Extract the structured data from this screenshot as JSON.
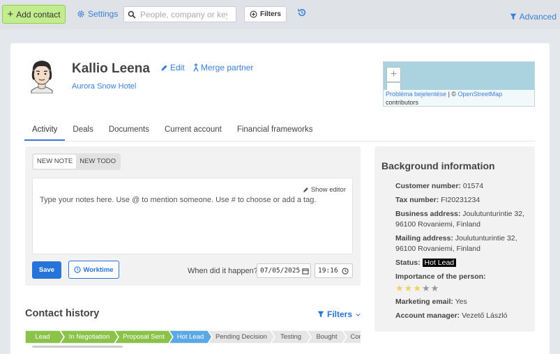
{
  "toolbar": {
    "add_contact": "Add contact",
    "settings": "Settings",
    "search_placeholder": "People, company or keyw",
    "filters": "Filters",
    "advanced": "Advanced"
  },
  "contact": {
    "name": "Kallio Leena",
    "edit": "Edit",
    "merge": "Merge partner",
    "company": "Aurora Snow Hotel"
  },
  "map": {
    "zoom_in": "+",
    "report_problem": "Probléma bejelentése",
    "separator": " | © ",
    "osm": "OpenStreetMap",
    "contributors": "contributors"
  },
  "tabs": [
    {
      "label": "Activity",
      "active": true
    },
    {
      "label": "Deals"
    },
    {
      "label": "Documents"
    },
    {
      "label": "Current account"
    },
    {
      "label": "Financial frameworks"
    }
  ],
  "note": {
    "tab_new_note": "NEW NOTE",
    "tab_new_todo": "NEW TODO",
    "show_editor": "Show editor",
    "placeholder": "Type your notes here. Use @ to mention someone. Use # to choose or add a tag.",
    "save": "Save",
    "worktime": "Worktime",
    "when_label": "When did it happen?",
    "date": "07/05/2025",
    "time": "19:16"
  },
  "history": {
    "title": "Contact history",
    "filters": "Filters",
    "stages": [
      {
        "label": "Lead",
        "color": "#8bc34a"
      },
      {
        "label": "In Negotiation",
        "color": "#8bc34a"
      },
      {
        "label": "Proposal Sent",
        "color": "#8bc34a"
      },
      {
        "label": "Hot Lead",
        "color": "#5aa9e6"
      },
      {
        "label": "Pending Decision",
        "color": "#e6e6e6"
      },
      {
        "label": "Testing",
        "color": "#e6e6e6"
      },
      {
        "label": "Bought",
        "color": "#e6e6e6"
      },
      {
        "label": "Contr",
        "color": "#e6e6e6"
      }
    ]
  },
  "background": {
    "title": "Background information",
    "customer_number_label": "Customer number:",
    "customer_number": "01574",
    "tax_number_label": "Tax number:",
    "tax_number": "FI20231234",
    "business_address_label": "Business address:",
    "business_address": "Joulutunturintie 32, 96100 Rovaniemi, Finland",
    "mailing_address_label": "Mailing address:",
    "mailing_address": "Joulutunturintie 32, 96100 Rovaniemi, Finland",
    "status_label": "Status:",
    "status": "Hot Lead",
    "importance_label": "Importance of the person:",
    "importance_rating": 3,
    "importance_max": 5,
    "marketing_email_label": "Marketing email:",
    "marketing_email": "Yes",
    "account_manager_label": "Account manager:",
    "account_manager": "Vezető László"
  }
}
